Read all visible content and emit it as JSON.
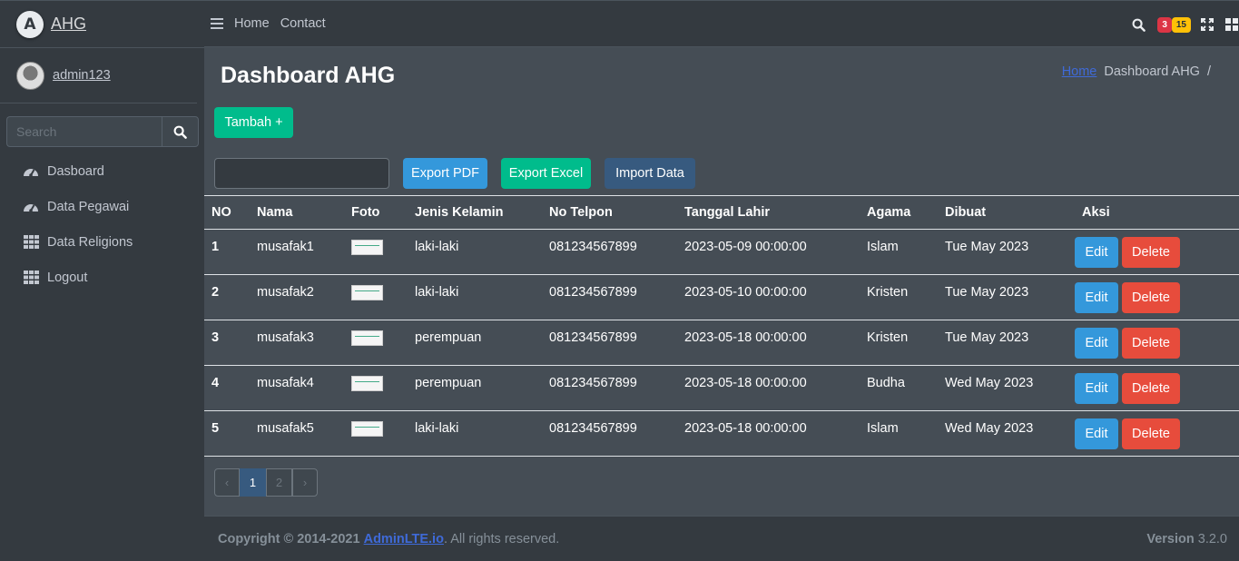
{
  "brand": {
    "logo_letter": "A",
    "name": "AHG"
  },
  "user": {
    "name": "admin123"
  },
  "search": {
    "placeholder": "Search"
  },
  "sidebar": {
    "items": [
      {
        "label": "Dasboard",
        "icon": "tachometer-icon"
      },
      {
        "label": "Data Pegawai",
        "icon": "tachometer-icon"
      },
      {
        "label": "Data Religions",
        "icon": "grid-icon"
      },
      {
        "label": "Logout",
        "icon": "grid-icon"
      }
    ]
  },
  "topnav": {
    "links": [
      "Home",
      "Contact"
    ],
    "badge_messages": "3",
    "badge_notifications": "15"
  },
  "page": {
    "title": "Dashboard AHG",
    "breadcrumb": {
      "home": "Home",
      "current": "Dashboard AHG",
      "separator": "/"
    }
  },
  "actions": {
    "add": "Tambah +",
    "export_pdf": "Export PDF",
    "export_excel": "Export Excel",
    "import": "Import Data"
  },
  "table": {
    "headers": [
      "NO",
      "Nama",
      "Foto",
      "Jenis Kelamin",
      "No Telpon",
      "Tanggal Lahir",
      "Agama",
      "Dibuat",
      "Aksi"
    ],
    "rows": [
      {
        "no": "1",
        "nama": "musafak1",
        "jk": "laki-laki",
        "telp": "081234567899",
        "tgl": "2023-05-09 00:00:00",
        "agama": "Islam",
        "dibuat": "Tue May 2023"
      },
      {
        "no": "2",
        "nama": "musafak2",
        "jk": "laki-laki",
        "telp": "081234567899",
        "tgl": "2023-05-10 00:00:00",
        "agama": "Kristen",
        "dibuat": "Tue May 2023"
      },
      {
        "no": "3",
        "nama": "musafak3",
        "jk": "perempuan",
        "telp": "081234567899",
        "tgl": "2023-05-18 00:00:00",
        "agama": "Kristen",
        "dibuat": "Tue May 2023"
      },
      {
        "no": "4",
        "nama": "musafak4",
        "jk": "perempuan",
        "telp": "081234567899",
        "tgl": "2023-05-18 00:00:00",
        "agama": "Budha",
        "dibuat": "Wed May 2023"
      },
      {
        "no": "5",
        "nama": "musafak5",
        "jk": "laki-laki",
        "telp": "081234567899",
        "tgl": "2023-05-18 00:00:00",
        "agama": "Islam",
        "dibuat": "Wed May 2023"
      }
    ],
    "edit_label": "Edit",
    "delete_label": "Delete"
  },
  "pagination": {
    "prev": "‹",
    "pages": [
      "1",
      "2"
    ],
    "next": "›",
    "current": "1"
  },
  "footer": {
    "copyright": "Copyright © 2014-2021",
    "brand_link": "AdminLTE.io",
    "suffix": ". All rights reserved.",
    "version_label": "Version",
    "version": "3.2.0"
  },
  "colors": {
    "background": "#454d55",
    "sidebar": "#343a40",
    "success": "#00bc8c",
    "info": "#3498db",
    "primary": "#375a7f",
    "danger": "#e74c3c"
  }
}
